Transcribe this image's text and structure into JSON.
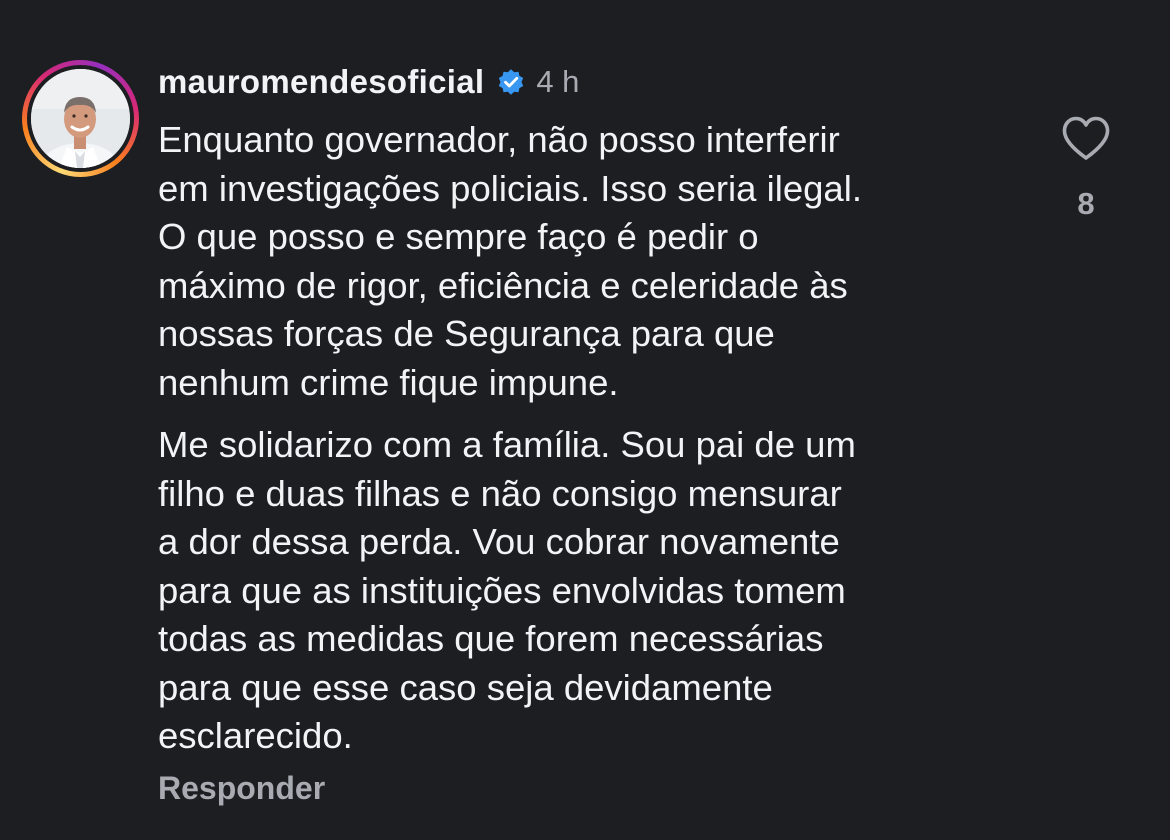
{
  "comment": {
    "username": "mauromendesoficial",
    "verified_icon": "verified-badge-icon",
    "time": "4 h",
    "paragraphs": [
      "Enquanto governador, não posso interferir\nem investigações policiais. Isso seria ilegal.\nO que posso e sempre faço é pedir o\nmáximo de rigor, eficiência e celeridade às\nnossas forças de Segurança para que\nnenhum crime fique impune.",
      "Me solidarizo com a família. Sou pai de um\nfilho e duas filhas e não consigo mensurar\na dor dessa perda. Vou cobrar novamente\npara que as instituições envolvidas tomem\ntodas as medidas que forem necessárias\npara que esse caso seja devidamente\nesclarecido."
    ],
    "reply_label": "Responder",
    "like_icon": "heart-outline-icon",
    "like_count": "8"
  },
  "colors": {
    "background": "#1c1e22",
    "text": "#f2f3f5",
    "muted": "#a8abb1",
    "verified": "#3897f0"
  }
}
